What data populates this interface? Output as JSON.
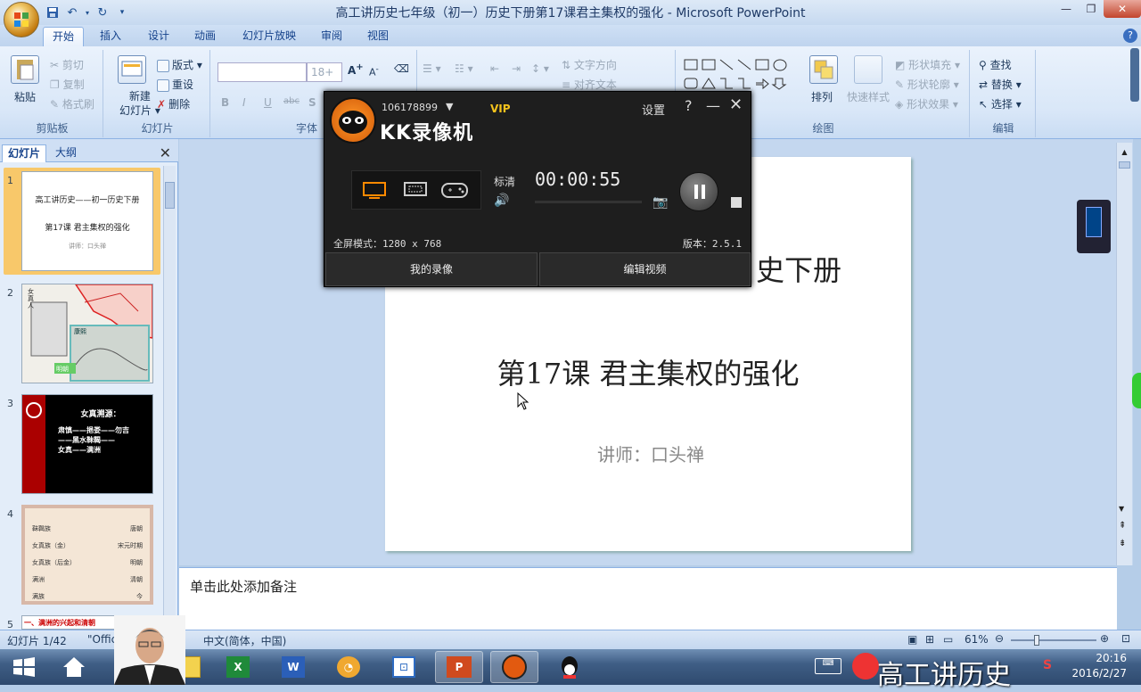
{
  "window": {
    "title": "高工讲历史七年级（初一）历史下册第17课君主集权的强化 - Microsoft PowerPoint",
    "controls": {
      "minimize": "—",
      "restore": "❐",
      "close": "✕"
    }
  },
  "ribbon_tabs": [
    "开始",
    "插入",
    "设计",
    "动画",
    "幻灯片放映",
    "审阅",
    "视图"
  ],
  "ribbon": {
    "clipboard": {
      "paste": "粘贴",
      "cut": "剪切",
      "copy": "复制",
      "format_painter": "格式刷",
      "label": "剪贴板"
    },
    "slides": {
      "new_slide": "新建\n幻灯片",
      "new_slide_l1": "新建",
      "new_slide_l2": "幻灯片",
      "layout": "版式",
      "reset": "重设",
      "delete": "删除",
      "label": "幻灯片"
    },
    "font": {
      "size": "18+",
      "label": "字体"
    },
    "paragraph": {
      "text_direction": "文字方向",
      "align_text": "对齐文本"
    },
    "drawing": {
      "arrange": "排列",
      "quick_styles": "快速样式",
      "shape_fill": "形状填充",
      "shape_outline": "形状轮廓",
      "shape_effects": "形状效果",
      "label": "绘图"
    },
    "editing": {
      "find": "查找",
      "replace": "替换",
      "select": "选择",
      "label": "编辑"
    }
  },
  "pane_tabs": {
    "slides": "幻灯片",
    "outline": "大纲"
  },
  "thumbnails": [
    {
      "num": "1",
      "line1": "高工讲历史——初一历史下册",
      "line2": "第17课 君主集权的强化",
      "line3": "讲师：口头禅"
    },
    {
      "num": "2",
      "caption1": "女真人",
      "caption2": "康熙",
      "caption3": "明朝"
    },
    {
      "num": "3",
      "title": "女真溯源：",
      "l1": "肃慎——挹娄——勿吉",
      "l2": "——黑水靺鞨——",
      "l3": "女真——满洲"
    },
    {
      "num": "4",
      "rows": [
        [
          "靺鞨族",
          "唐朝"
        ],
        [
          "女真族（金）",
          "宋元时期"
        ],
        [
          "女真族（后金）",
          "明朝"
        ],
        [
          "满洲",
          "清朝"
        ],
        [
          "满族",
          "今"
        ]
      ]
    },
    {
      "num": "5",
      "caption": "一、满洲的兴起和清朝"
    }
  ],
  "slide": {
    "title_line1_visible": "史下册",
    "title_line2": "第17课 君主集权的强化",
    "subtitle": "讲师：口头禅"
  },
  "notes_placeholder": "单击此处添加备注",
  "status": {
    "slide_pos": "幻灯片 1/42",
    "theme": "\"Offic",
    "language": "中文(简体，中国)",
    "zoom": "61%"
  },
  "kk": {
    "account": "106178899",
    "vip": "VIP",
    "app_name": "KK录像机",
    "settings": "设置",
    "help": "?",
    "quality": "标清",
    "timer": "00:00:55",
    "mode": "全屏模式：1280 x 768",
    "version": "版本：2.5.1",
    "my_recordings": "我的录像",
    "edit_video": "编辑视频"
  },
  "taskbar": {
    "overlay_text": "高工讲历史",
    "time": "20:16",
    "date": "2016/2/27"
  },
  "colors": {
    "ribbon": "#dbe7f6",
    "kk_bg": "#1e1e1e",
    "kk_accent": "#ff8a00",
    "taskbar": "#3f5e86"
  }
}
